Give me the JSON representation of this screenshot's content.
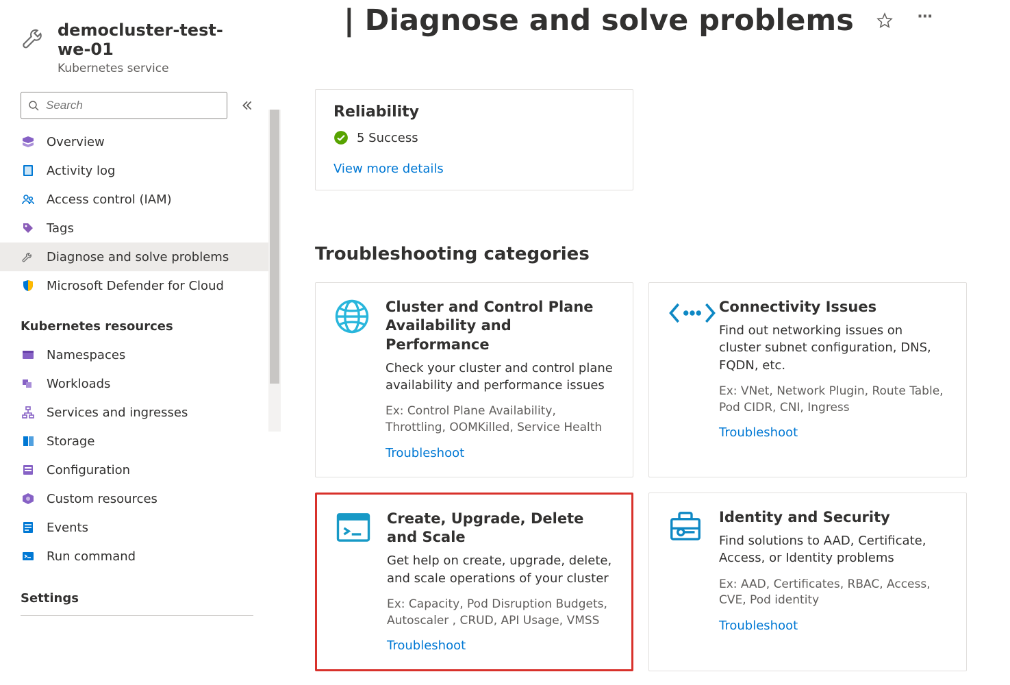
{
  "page": {
    "title": "| Diagnose and solve problems"
  },
  "cluster": {
    "name": "democluster-test-we-01",
    "subtitle": "Kubernetes service"
  },
  "search": {
    "placeholder": "Search"
  },
  "nav_main": [
    {
      "label": "Overview",
      "icon": "aks"
    },
    {
      "label": "Activity log",
      "icon": "log"
    },
    {
      "label": "Access control (IAM)",
      "icon": "people"
    },
    {
      "label": "Tags",
      "icon": "tag"
    },
    {
      "label": "Diagnose and solve problems",
      "icon": "wrench",
      "active": true
    },
    {
      "label": "Microsoft Defender for Cloud",
      "icon": "shield"
    }
  ],
  "nav_resources_label": "Kubernetes resources",
  "nav_resources": [
    {
      "label": "Namespaces",
      "icon": "ns"
    },
    {
      "label": "Workloads",
      "icon": "workload"
    },
    {
      "label": "Services and ingresses",
      "icon": "svc"
    },
    {
      "label": "Storage",
      "icon": "storage"
    },
    {
      "label": "Configuration",
      "icon": "config"
    },
    {
      "label": "Custom resources",
      "icon": "custom"
    },
    {
      "label": "Events",
      "icon": "events"
    },
    {
      "label": "Run command",
      "icon": "run"
    }
  ],
  "settings_label": "Settings",
  "reliability": {
    "title": "Reliability",
    "status": "5 Success",
    "link": "View more details"
  },
  "categories_heading": "Troubleshooting categories",
  "troubleshoot_label": "Troubleshoot",
  "cards": [
    {
      "title": "Cluster and Control Plane Availability and Performance",
      "desc": "Check your cluster and control plane availability and performance issues",
      "ex": "Ex: Control Plane Availability, Throttling, OOMKilled, Service Health",
      "icon": "globe",
      "highlight": false
    },
    {
      "title": "Connectivity Issues",
      "desc": "Find out networking issues on cluster subnet configuration, DNS, FQDN, etc.",
      "ex": "Ex: VNet, Network Plugin, Route Table, Pod CIDR, CNI, Ingress",
      "icon": "connectivity",
      "highlight": false
    },
    {
      "title": "Create, Upgrade, Delete and Scale",
      "desc": "Get help on create, upgrade, delete, and scale operations of your cluster",
      "ex": "Ex: Capacity, Pod Disruption Budgets, Autoscaler , CRUD, API Usage, VMSS",
      "icon": "terminal",
      "highlight": true
    },
    {
      "title": "Identity and Security",
      "desc": "Find solutions to AAD, Certificate, Access, or Identity problems",
      "ex": "Ex: AAD, Certificates, RBAC, Access, CVE, Pod identity",
      "icon": "toolbox",
      "highlight": false
    }
  ]
}
